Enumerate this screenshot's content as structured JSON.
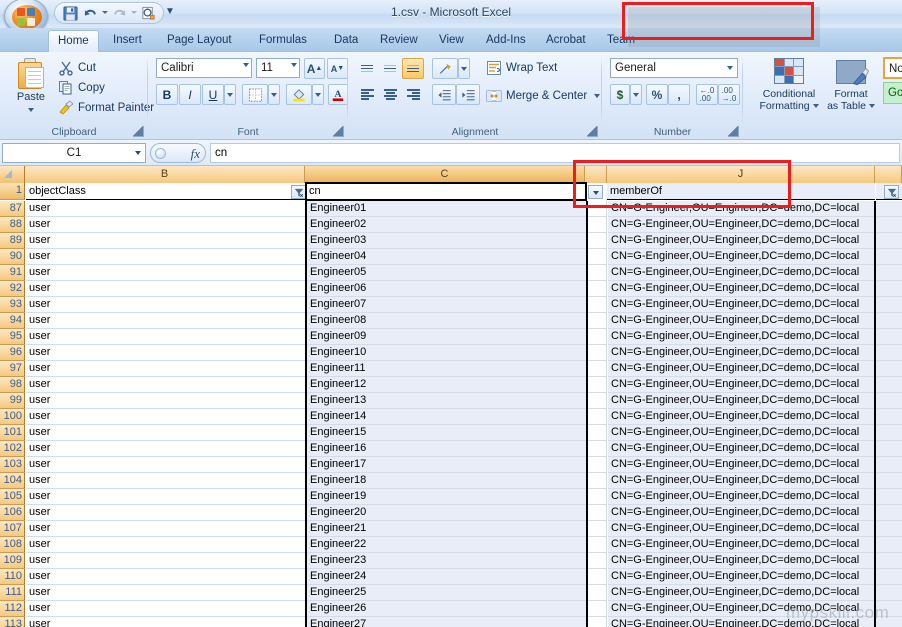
{
  "window": {
    "title": "1.csv - Microsoft Excel"
  },
  "quick_access": {
    "save": "save-icon",
    "undo": "undo-icon",
    "redo": "redo-icon",
    "print_preview": "print-preview-icon",
    "customize": "customize-quick-access-toolbar"
  },
  "tabs": [
    {
      "label": "Home",
      "active": true
    },
    {
      "label": "Insert",
      "active": false
    },
    {
      "label": "Page Layout",
      "active": false
    },
    {
      "label": "Formulas",
      "active": false
    },
    {
      "label": "Data",
      "active": false
    },
    {
      "label": "Review",
      "active": false
    },
    {
      "label": "View",
      "active": false
    },
    {
      "label": "Add-Ins",
      "active": false
    },
    {
      "label": "Acrobat",
      "active": false
    },
    {
      "label": "Team",
      "active": false
    }
  ],
  "ribbon": {
    "clipboard": {
      "group_label": "Clipboard",
      "paste": "Paste",
      "cut": "Cut",
      "copy": "Copy",
      "format_painter": "Format Painter"
    },
    "font": {
      "group_label": "Font",
      "font_name": "Calibri",
      "font_size": "11",
      "bold": "B",
      "italic": "I",
      "underline": "U",
      "grow_font": "A",
      "shrink_font": "A"
    },
    "alignment": {
      "group_label": "Alignment",
      "wrap_text": "Wrap Text",
      "merge_center": "Merge & Center"
    },
    "number": {
      "group_label": "Number",
      "format": "General",
      "currency": "$",
      "percent": "%",
      "comma": ","
    },
    "styles": {
      "conditional_formatting": "Conditional\nFormatting",
      "conditional_formatting_l1": "Conditional",
      "conditional_formatting_l2": "Formatting",
      "format_as_table_l1": "Format",
      "format_as_table_l2": "as Table",
      "style_normal": "Nor",
      "style_good": "Goo"
    }
  },
  "formula_bar": {
    "name_box": "C1",
    "formula": "cn",
    "fx": "fx"
  },
  "grid": {
    "columns": [
      {
        "letter": "",
        "type": "corner"
      },
      {
        "letter": "B",
        "type": "normal"
      },
      {
        "letter": "C",
        "type": "selected"
      },
      {
        "letter": "",
        "type": "narrow"
      },
      {
        "letter": "J",
        "type": "normal"
      },
      {
        "letter": "",
        "type": "partial"
      }
    ],
    "header_row": {
      "number": "1",
      "objectClass": "objectClass",
      "cn": "cn",
      "memberOf": "memberOf"
    },
    "rows": [
      {
        "num": "87",
        "objectClass": "user",
        "cn": "Engineer01",
        "memberOf": "CN=G-Engineer,OU=Engineer,DC=demo,DC=local"
      },
      {
        "num": "88",
        "objectClass": "user",
        "cn": "Engineer02",
        "memberOf": "CN=G-Engineer,OU=Engineer,DC=demo,DC=local"
      },
      {
        "num": "89",
        "objectClass": "user",
        "cn": "Engineer03",
        "memberOf": "CN=G-Engineer,OU=Engineer,DC=demo,DC=local"
      },
      {
        "num": "90",
        "objectClass": "user",
        "cn": "Engineer04",
        "memberOf": "CN=G-Engineer,OU=Engineer,DC=demo,DC=local"
      },
      {
        "num": "91",
        "objectClass": "user",
        "cn": "Engineer05",
        "memberOf": "CN=G-Engineer,OU=Engineer,DC=demo,DC=local"
      },
      {
        "num": "92",
        "objectClass": "user",
        "cn": "Engineer06",
        "memberOf": "CN=G-Engineer,OU=Engineer,DC=demo,DC=local"
      },
      {
        "num": "93",
        "objectClass": "user",
        "cn": "Engineer07",
        "memberOf": "CN=G-Engineer,OU=Engineer,DC=demo,DC=local"
      },
      {
        "num": "94",
        "objectClass": "user",
        "cn": "Engineer08",
        "memberOf": "CN=G-Engineer,OU=Engineer,DC=demo,DC=local"
      },
      {
        "num": "95",
        "objectClass": "user",
        "cn": "Engineer09",
        "memberOf": "CN=G-Engineer,OU=Engineer,DC=demo,DC=local"
      },
      {
        "num": "96",
        "objectClass": "user",
        "cn": "Engineer10",
        "memberOf": "CN=G-Engineer,OU=Engineer,DC=demo,DC=local"
      },
      {
        "num": "97",
        "objectClass": "user",
        "cn": "Engineer11",
        "memberOf": "CN=G-Engineer,OU=Engineer,DC=demo,DC=local"
      },
      {
        "num": "98",
        "objectClass": "user",
        "cn": "Engineer12",
        "memberOf": "CN=G-Engineer,OU=Engineer,DC=demo,DC=local"
      },
      {
        "num": "99",
        "objectClass": "user",
        "cn": "Engineer13",
        "memberOf": "CN=G-Engineer,OU=Engineer,DC=demo,DC=local"
      },
      {
        "num": "100",
        "objectClass": "user",
        "cn": "Engineer14",
        "memberOf": "CN=G-Engineer,OU=Engineer,DC=demo,DC=local"
      },
      {
        "num": "101",
        "objectClass": "user",
        "cn": "Engineer15",
        "memberOf": "CN=G-Engineer,OU=Engineer,DC=demo,DC=local"
      },
      {
        "num": "102",
        "objectClass": "user",
        "cn": "Engineer16",
        "memberOf": "CN=G-Engineer,OU=Engineer,DC=demo,DC=local"
      },
      {
        "num": "103",
        "objectClass": "user",
        "cn": "Engineer17",
        "memberOf": "CN=G-Engineer,OU=Engineer,DC=demo,DC=local"
      },
      {
        "num": "104",
        "objectClass": "user",
        "cn": "Engineer18",
        "memberOf": "CN=G-Engineer,OU=Engineer,DC=demo,DC=local"
      },
      {
        "num": "105",
        "objectClass": "user",
        "cn": "Engineer19",
        "memberOf": "CN=G-Engineer,OU=Engineer,DC=demo,DC=local"
      },
      {
        "num": "106",
        "objectClass": "user",
        "cn": "Engineer20",
        "memberOf": "CN=G-Engineer,OU=Engineer,DC=demo,DC=local"
      },
      {
        "num": "107",
        "objectClass": "user",
        "cn": "Engineer21",
        "memberOf": "CN=G-Engineer,OU=Engineer,DC=demo,DC=local"
      },
      {
        "num": "108",
        "objectClass": "user",
        "cn": "Engineer22",
        "memberOf": "CN=G-Engineer,OU=Engineer,DC=demo,DC=local"
      },
      {
        "num": "109",
        "objectClass": "user",
        "cn": "Engineer23",
        "memberOf": "CN=G-Engineer,OU=Engineer,DC=demo,DC=local"
      },
      {
        "num": "110",
        "objectClass": "user",
        "cn": "Engineer24",
        "memberOf": "CN=G-Engineer,OU=Engineer,DC=demo,DC=local"
      },
      {
        "num": "111",
        "objectClass": "user",
        "cn": "Engineer25",
        "memberOf": "CN=G-Engineer,OU=Engineer,DC=demo,DC=local"
      },
      {
        "num": "112",
        "objectClass": "user",
        "cn": "Engineer26",
        "memberOf": "CN=G-Engineer,OU=Engineer,DC=demo,DC=local"
      },
      {
        "num": "113",
        "objectClass": "user",
        "cn": "Engineer27",
        "memberOf": "CN=G-Engineer,OU=Engineer,DC=demo,DC=local"
      }
    ]
  },
  "annotations": {
    "color": "#ef1c1c",
    "title_highlight": "1.csv - Microsoft Excel",
    "column_highlight": "memberOf"
  },
  "watermark": "mypskill.com"
}
